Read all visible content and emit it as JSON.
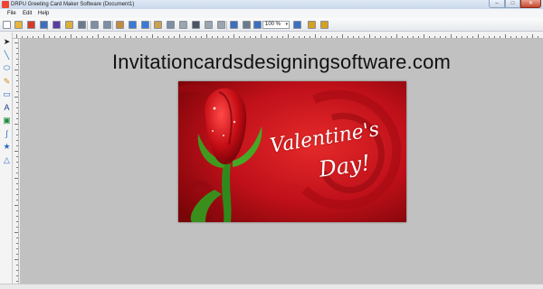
{
  "window": {
    "title": "DRPU Greeting Card Maker Software  (Document1)",
    "minimize_glyph": "–",
    "maximize_glyph": "□",
    "close_glyph": "✕"
  },
  "menu": {
    "items": [
      {
        "label": "File"
      },
      {
        "label": "Edit"
      },
      {
        "label": "Help"
      }
    ]
  },
  "toolbar": {
    "zoom_value": "100 %",
    "zoom_arrow": "▾",
    "buttons": [
      {
        "name": "new-document-icon",
        "color": "#ffffff"
      },
      {
        "name": "open-folder-icon",
        "color": "#e8b53a"
      },
      {
        "name": "close-document-icon",
        "color": "#d63a2a"
      },
      {
        "name": "save-icon",
        "color": "#3a6fc2"
      },
      {
        "name": "save-as-icon",
        "color": "#5a3aa8"
      },
      {
        "name": "page-setup-icon",
        "color": "#d9b03a"
      },
      {
        "name": "print-icon",
        "color": "#6a7a8a"
      },
      {
        "name": "cut-icon",
        "color": "#7c8fa4"
      },
      {
        "name": "copy-icon",
        "color": "#7c8fa4"
      },
      {
        "name": "paste-icon",
        "color": "#c48b3a"
      },
      {
        "name": "undo-icon",
        "color": "#3a7ad6"
      },
      {
        "name": "redo-icon",
        "color": "#3a7ad6"
      },
      {
        "name": "image-icon",
        "color": "#c9a24a"
      },
      {
        "name": "scissors-icon",
        "color": "#7c8fa4"
      },
      {
        "name": "duplicate-icon",
        "color": "#9aa5b0"
      },
      {
        "name": "delete-icon",
        "color": "#4b5563"
      },
      {
        "name": "bring-front-icon",
        "color": "#9aa5b0"
      },
      {
        "name": "send-back-icon",
        "color": "#9aa5b0"
      },
      {
        "name": "grid-icon",
        "color": "#3a6fc2"
      },
      {
        "name": "grid-off-icon",
        "color": "#6a7a8a"
      },
      {
        "name": "zoom-in-icon",
        "color": "#3a6fc2"
      },
      {
        "name": "zoom-out-icon",
        "color": "#3a6fc2"
      },
      {
        "name": "lock-icon",
        "color": "#d9a020"
      },
      {
        "name": "unlock-icon",
        "color": "#d9a020"
      }
    ]
  },
  "left_tools": [
    {
      "name": "select-pointer-icon",
      "glyph": "➤"
    },
    {
      "name": "line-tool-icon",
      "glyph": "╲"
    },
    {
      "name": "ellipse-tool-icon",
      "glyph": "⬭"
    },
    {
      "name": "pencil-tool-icon",
      "glyph": "✎"
    },
    {
      "name": "rectangle-tool-icon",
      "glyph": "▭"
    },
    {
      "name": "text-tool-icon",
      "glyph": "A"
    },
    {
      "name": "image-tool-icon",
      "glyph": "▣"
    },
    {
      "name": "curve-tool-icon",
      "glyph": "∫"
    },
    {
      "name": "star-tool-icon",
      "glyph": "★"
    },
    {
      "name": "triangle-tool-icon",
      "glyph": "△"
    }
  ],
  "canvas": {
    "heading": "Invitationcardsdesigningsoftware.com",
    "card": {
      "line1": "Valentine's",
      "line2": "Day!"
    }
  },
  "colors": {
    "canvas_bg": "#c1c1c1",
    "rose_red": "#c8101a",
    "leaf_green": "#3f9a1f"
  }
}
